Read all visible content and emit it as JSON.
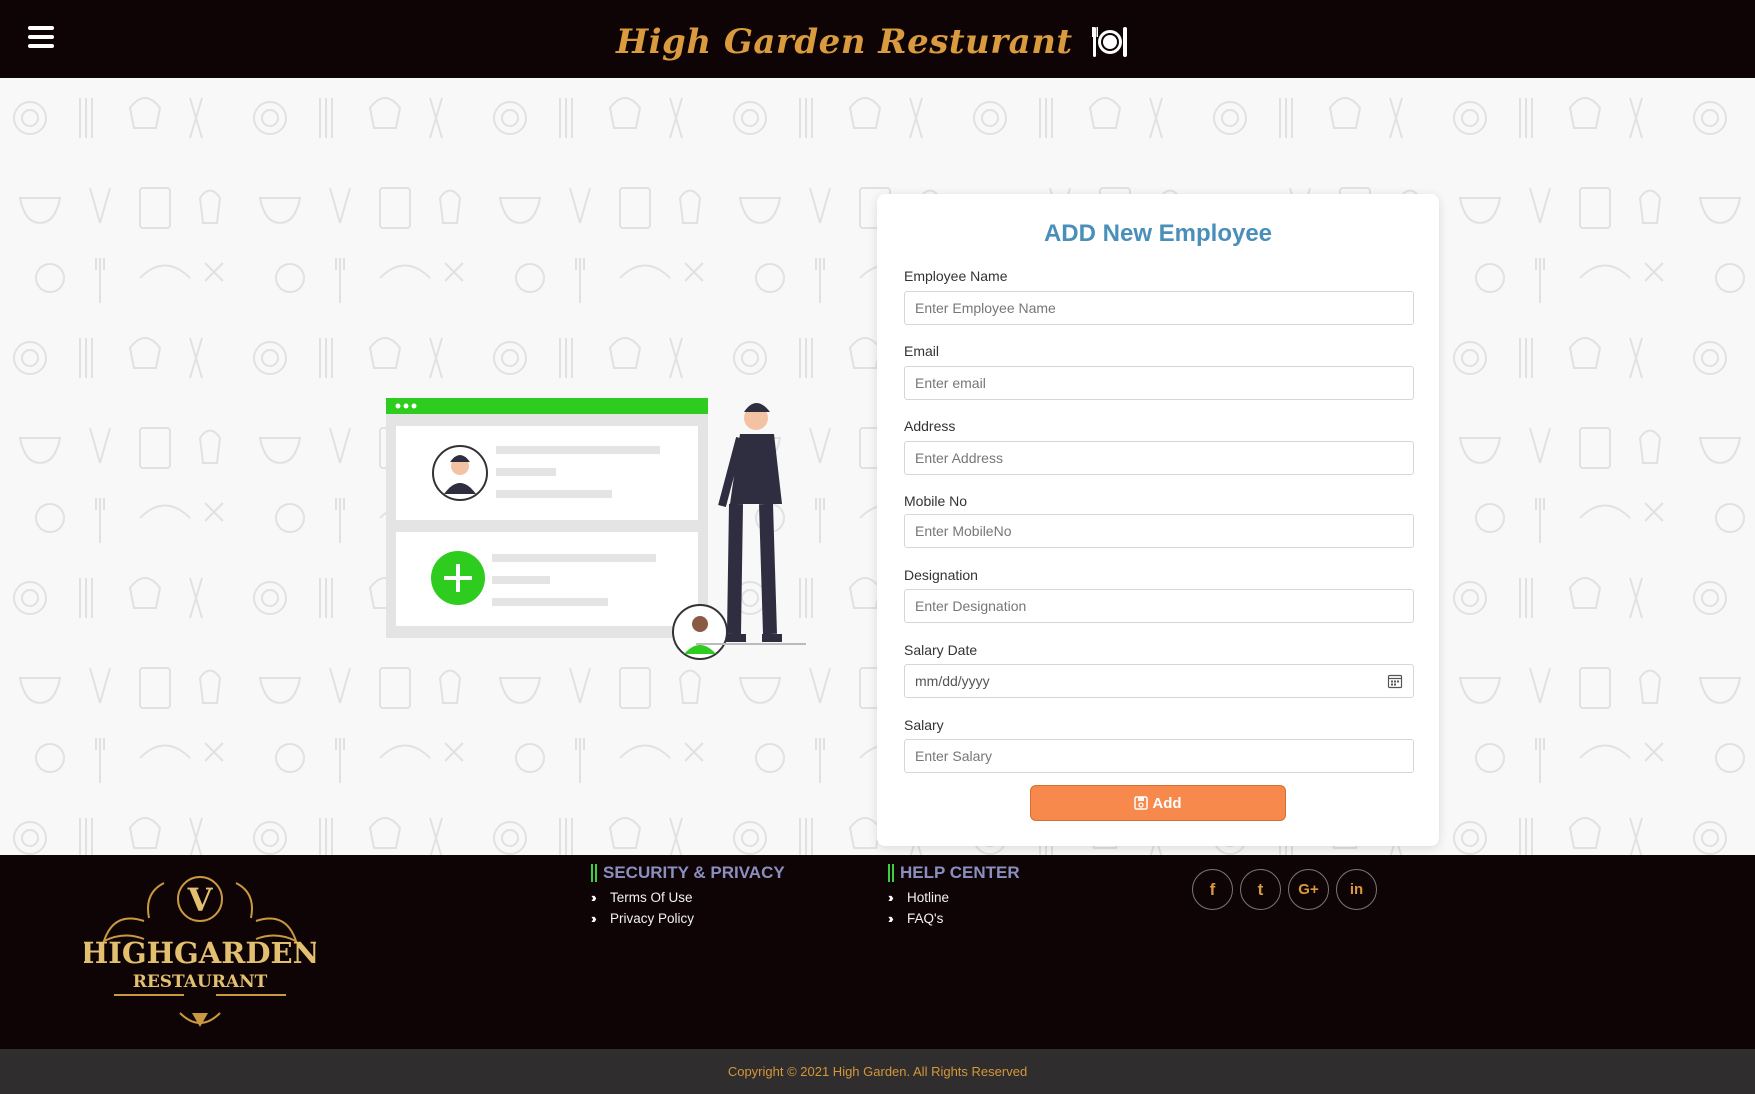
{
  "header": {
    "brand_title": "High Garden Resturant"
  },
  "form": {
    "title": "ADD New Employee",
    "fields": [
      {
        "label": "Employee Name",
        "placeholder": "Enter Employee Name"
      },
      {
        "label": "Email",
        "placeholder": "Enter email"
      },
      {
        "label": "Address",
        "placeholder": "Enter Address"
      },
      {
        "label": "Mobile No",
        "placeholder": "Enter MobileNo"
      },
      {
        "label": "Designation",
        "placeholder": "Enter Designation"
      },
      {
        "label": "Salary Date",
        "value": "mm/dd/yyyy"
      },
      {
        "label": "Salary",
        "placeholder": "Enter Salary"
      }
    ],
    "submit_label": "Add"
  },
  "footer": {
    "logo": {
      "letter": "V",
      "line1": "HIGHGARDEN",
      "line2": "RESTAURANT"
    },
    "security": {
      "heading": "SECURITY & PRIVACY",
      "links": [
        "Terms Of Use",
        "Privacy Policy"
      ]
    },
    "help": {
      "heading": "HELP CENTER",
      "links": [
        "Hotline",
        "FAQ's"
      ]
    },
    "social": [
      {
        "icon": "facebook-icon",
        "glyph": "f"
      },
      {
        "icon": "twitter-icon",
        "glyph": "t"
      },
      {
        "icon": "google-plus-icon",
        "glyph": "G+"
      },
      {
        "icon": "linkedin-icon",
        "glyph": "in"
      }
    ],
    "copyright": "Copyright © 2021 High Garden. All Rights Reserved"
  },
  "colors": {
    "header_bg": "#0f0405",
    "brand": "#d99b3d",
    "title": "#4a8fba",
    "button": "#f6894b",
    "accent_green": "#3ecf3e"
  }
}
